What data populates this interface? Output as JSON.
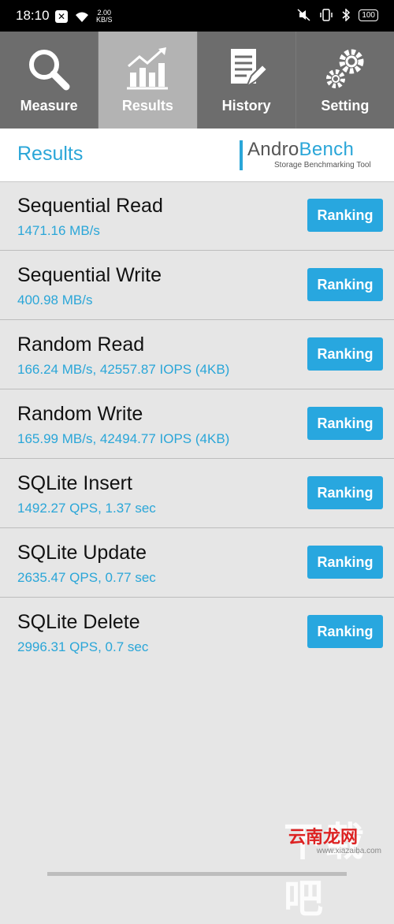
{
  "status_bar": {
    "time": "18:10",
    "net_speed_value": "2.00",
    "net_speed_unit": "KB/S",
    "battery": "100"
  },
  "tabs": [
    {
      "label": "Measure",
      "icon": "magnifier-icon",
      "active": false
    },
    {
      "label": "Results",
      "icon": "chart-icon",
      "active": true
    },
    {
      "label": "History",
      "icon": "document-pen-icon",
      "active": false
    },
    {
      "label": "Setting",
      "icon": "gears-icon",
      "active": false
    }
  ],
  "header": {
    "title": "Results",
    "logo_part1": "Andro",
    "logo_part2": "Bench",
    "logo_subtitle": "Storage Benchmarking Tool"
  },
  "results": [
    {
      "name": "Sequential Read",
      "value": "1471.16 MB/s",
      "button": "Ranking"
    },
    {
      "name": "Sequential Write",
      "value": "400.98 MB/s",
      "button": "Ranking"
    },
    {
      "name": "Random Read",
      "value": "166.24 MB/s, 42557.87 IOPS (4KB)",
      "button": "Ranking"
    },
    {
      "name": "Random Write",
      "value": "165.99 MB/s, 42494.77 IOPS (4KB)",
      "button": "Ranking"
    },
    {
      "name": "SQLite Insert",
      "value": "1492.27 QPS, 1.37 sec",
      "button": "Ranking"
    },
    {
      "name": "SQLite Update",
      "value": "2635.47 QPS, 0.77 sec",
      "button": "Ranking"
    },
    {
      "name": "SQLite Delete",
      "value": "2996.31 QPS, 0.7 sec",
      "button": "Ranking"
    }
  ],
  "watermark": {
    "big": "下载吧",
    "red": "云南龙网",
    "url": "www.xiazaiba.com"
  },
  "colors": {
    "accent": "#2aa6d8",
    "tab_bg": "#6d6d6d",
    "tab_active_bg": "#b3b3b3",
    "list_bg": "#e6e6e6"
  }
}
